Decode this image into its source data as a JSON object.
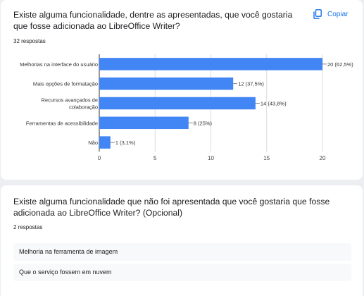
{
  "question1": {
    "title": "Existe alguma funcionalidade, dentre as apresentadas, que você gostaria que fosse adicionada ao LibreOffice Writer?",
    "responses": "32 respostas",
    "copy_label": "Copiar"
  },
  "chart_data": {
    "type": "bar",
    "orientation": "horizontal",
    "categories": [
      [
        "Melhorias na interface do usuário"
      ],
      [
        "Mais opções de formatação"
      ],
      [
        "Recursos avançados de",
        "colaboração"
      ],
      [
        "Ferramentas de acessibilidade"
      ],
      [
        "Não"
      ]
    ],
    "values": [
      20,
      12,
      14,
      8,
      1
    ],
    "data_labels": [
      "20 (62,5%)",
      "12 (37,5%)",
      "14 (43,8%)",
      "8 (25%)",
      "1 (3,1%)"
    ],
    "xlim": [
      0,
      20
    ],
    "xticks": [
      "0",
      "5",
      "10",
      "15",
      "20"
    ],
    "xtick_values": [
      0,
      5,
      10,
      15,
      20
    ],
    "grid": true,
    "bar_color": "#4285f4"
  },
  "question2": {
    "title": "Existe alguma funcionalidade que não foi apresentada que você gostaria que fosse adicionada ao LibreOffice Writer? (Opcional)",
    "responses": "2 respostas",
    "answers": [
      "Melhoria na ferramenta de imagem",
      "Que o serviço fossem em nuvem"
    ]
  },
  "colors": {
    "accent": "#1a73e8",
    "bar": "#4285f4"
  },
  "icons": {
    "copy": "copy-icon"
  }
}
